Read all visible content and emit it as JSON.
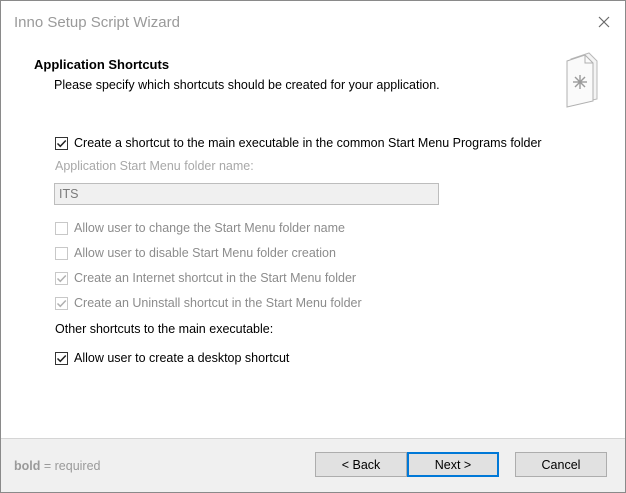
{
  "window": {
    "title": "Inno Setup Script Wizard"
  },
  "header": {
    "title": "Application Shortcuts",
    "subtitle": "Please specify which shortcuts should be created for your application."
  },
  "options": {
    "main_shortcut": {
      "label": "Create a shortcut to the main executable in the common Start Menu Programs folder",
      "checked": true,
      "enabled": true
    },
    "folder_name_label": "Application Start Menu folder name:",
    "folder_name_value": "ITS",
    "allow_change_folder": {
      "label": "Allow user to change the Start Menu folder name",
      "checked": false,
      "enabled": false
    },
    "allow_disable_folder": {
      "label": "Allow user to disable Start Menu folder creation",
      "checked": false,
      "enabled": false
    },
    "internet_shortcut": {
      "label": "Create an Internet shortcut in the Start Menu folder",
      "checked": true,
      "enabled": false
    },
    "uninstall_shortcut": {
      "label": "Create an Uninstall shortcut in the Start Menu folder",
      "checked": true,
      "enabled": false
    },
    "other_shortcuts_label": "Other shortcuts to the main executable:",
    "desktop_shortcut": {
      "label": "Allow user to create a desktop shortcut",
      "checked": true,
      "enabled": true
    }
  },
  "footer": {
    "note_bold": "bold",
    "note_rest": " = required",
    "back_label": "< Back",
    "next_label": "Next >",
    "cancel_label": "Cancel"
  },
  "colors": {
    "accent": "#0078d7",
    "footer_bg": "#f0f0f0",
    "disabled_text": "#8c8c8c"
  }
}
